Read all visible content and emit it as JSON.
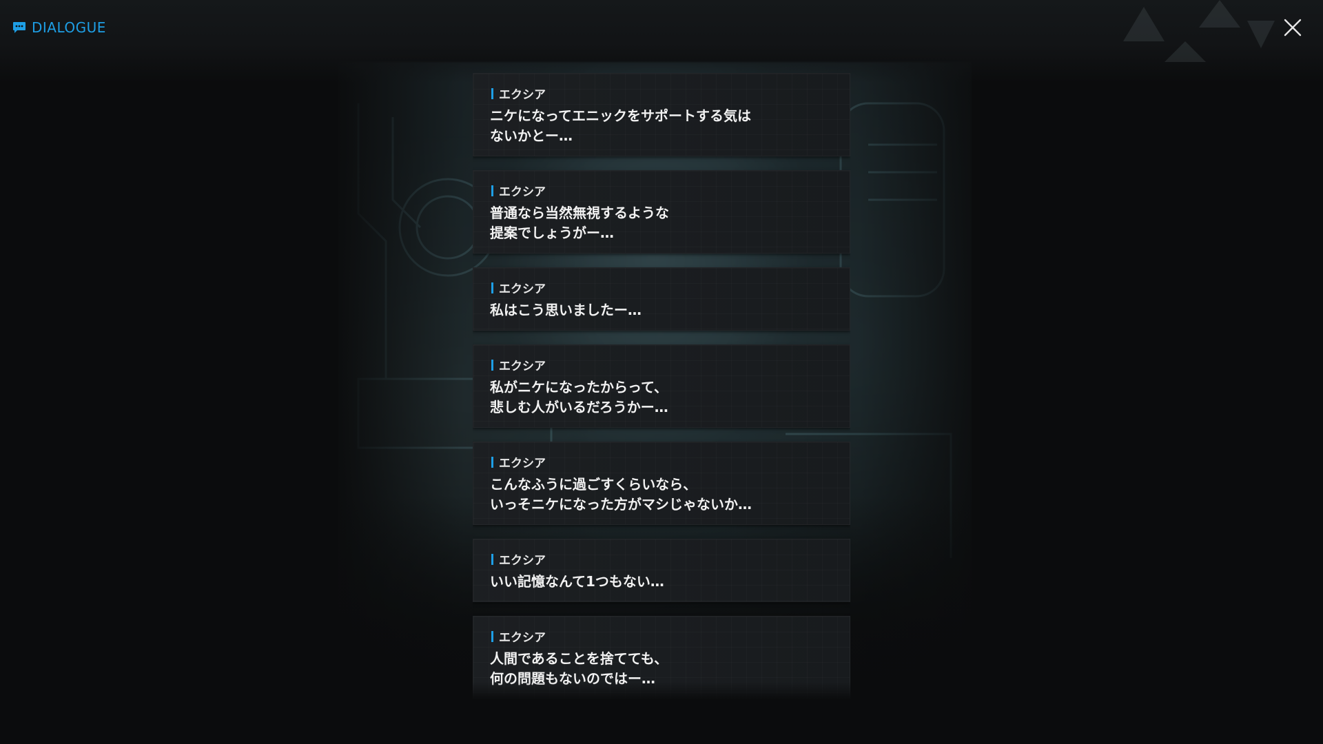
{
  "header": {
    "title": "DIALOGUE",
    "title_icon": "chat-bubble-icon",
    "close_icon": "close-icon",
    "accent_color": "#1e9fe6"
  },
  "dialogue": [
    {
      "speaker": "エクシア",
      "text": "ニケになってエニックをサポートする気は\nないかとー…"
    },
    {
      "speaker": "エクシア",
      "text": "普通なら当然無視するような\n提案でしょうがー…"
    },
    {
      "speaker": "エクシア",
      "text": "私はこう思いましたー…"
    },
    {
      "speaker": "エクシア",
      "text": "私がニケになったからって、\n悲しむ人がいるだろうかー…"
    },
    {
      "speaker": "エクシア",
      "text": "こんなふうに過ごすくらいなら、\nいっそニケになった方がマシじゃないか…"
    },
    {
      "speaker": "エクシア",
      "text": "いい記憶なんて1つもない…"
    },
    {
      "speaker": "エクシア",
      "text": "人間であることを捨てても、\n何の問題もないのではー…"
    }
  ]
}
